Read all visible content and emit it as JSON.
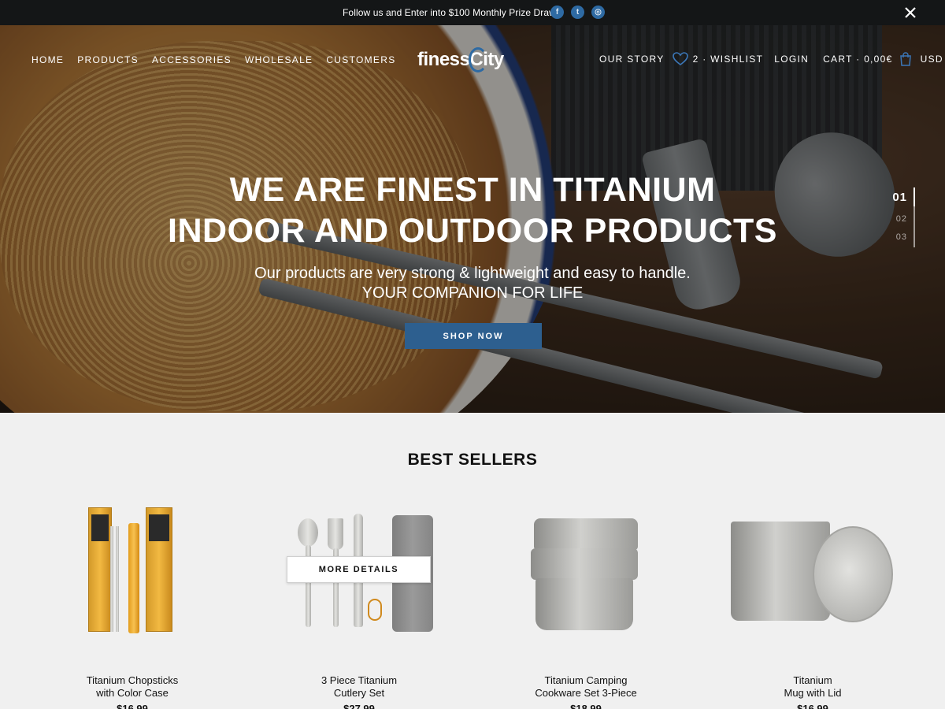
{
  "announcement": {
    "text": "Follow us and Enter into $100 Monthly Prize Draw",
    "social": [
      {
        "icon": "facebook-icon",
        "glyph": "f"
      },
      {
        "icon": "twitter-icon",
        "glyph": "t"
      },
      {
        "icon": "instagram-icon",
        "glyph": "◎"
      }
    ],
    "close_icon": "close-icon"
  },
  "nav": {
    "left": [
      "HOME",
      "PRODUCTS",
      "ACCESSORIES",
      "WHOLESALE",
      "CUSTOMERS"
    ],
    "logo": {
      "part1": "finess",
      "part2": "City"
    },
    "our_story": "OUR STORY",
    "wishlist": "2 · WISHLIST",
    "login": "LOGIN",
    "cart": "CART · 0,00€",
    "currency": "USD"
  },
  "hero": {
    "headline_line1": "WE ARE FINEST IN TITANIUM",
    "headline_line2": "INDOOR AND OUTDOOR PRODUCTS",
    "subline1": "Our products are very strong & lightweight and easy to handle.",
    "subline2": "YOUR COMPANION FOR LIFE",
    "cta": "SHOP NOW",
    "slides": [
      "01",
      "02",
      "03"
    ],
    "active_slide": "01"
  },
  "best_sellers": {
    "title": "BEST SELLERS",
    "hover_button": "MORE DETAILS",
    "products": [
      {
        "line1": "Titanium Chopsticks",
        "line2": "with Color Case",
        "price": "$16.99"
      },
      {
        "line1": "3 Piece Titanium",
        "line2": "Cutlery Set",
        "price": "$27.99"
      },
      {
        "line1": "Titanium Camping",
        "line2": "Cookware Set 3-Piece",
        "price": "$18.99"
      },
      {
        "line1": "Titanium",
        "line2": "Mug with Lid",
        "price": "$16.99"
      }
    ]
  },
  "colors": {
    "accent": "#2d5f8f",
    "topbar": "#141617",
    "background": "#f0f0f0"
  }
}
